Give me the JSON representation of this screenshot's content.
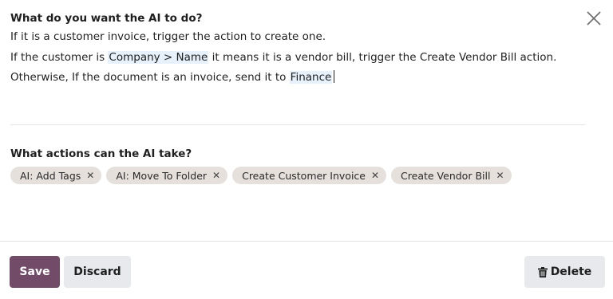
{
  "prompt": {
    "title": "What do you want the AI to do?",
    "line1": "If it is a customer invoice, trigger the action to create one.",
    "line2_pre": "If the customer is ",
    "line2_field": "Company > Name",
    "line2_post": " it means it is a vendor bill, trigger the Create Vendor Bill action.",
    "line3_pre": "Otherwise, If the document is an invoice, send it to ",
    "line3_field": "Finance"
  },
  "actions": {
    "title": "What actions can the AI take?",
    "tags": [
      {
        "label": "AI: Add Tags",
        "remove": "✕"
      },
      {
        "label": "AI: Move To Folder",
        "remove": "✕"
      },
      {
        "label": "Create Customer Invoice",
        "remove": "✕"
      },
      {
        "label": "Create Vendor Bill",
        "remove": "✕"
      }
    ]
  },
  "footer": {
    "save_label": "Save",
    "discard_label": "Discard",
    "delete_label": "Delete"
  },
  "icons": {
    "close": "close-icon",
    "delete": "trash-icon"
  },
  "colors": {
    "primary": "#714b67",
    "secondary_button": "#e7e9ed",
    "tag_background": "#e6e0dc",
    "field_highlight": "#e6f1fb"
  }
}
